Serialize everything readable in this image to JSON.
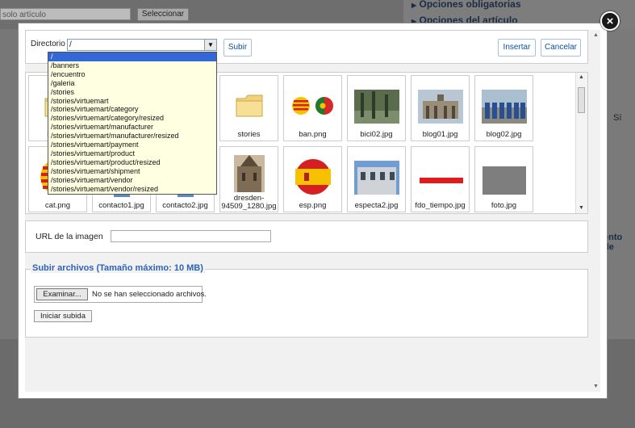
{
  "background": {
    "search_placeholder": "solo artículo",
    "select_button": "Seleccionar",
    "panel_1": "Opciones obligatorias",
    "panel_2": "Opciones del artículo",
    "side_text": "Sí",
    "side_text_2": "ento de"
  },
  "modal": {
    "close_glyph": "×",
    "directory_label": "Directorio",
    "directory_value": "/",
    "upload_button": "Subir",
    "insert_button": "Insertar",
    "cancel_button": "Cancelar",
    "directory_options": [
      "/",
      "/banners",
      "/encuentro",
      "/galeria",
      "/stories",
      "/stories/virtuemart",
      "/stories/virtuemart/category",
      "/stories/virtuemart/category/resized",
      "/stories/virtuemart/manufacturer",
      "/stories/virtuemart/manufacturer/resized",
      "/stories/virtuemart/payment",
      "/stories/virtuemart/product",
      "/stories/virtuemart/product/resized",
      "/stories/virtuemart/shipment",
      "/stories/virtuemart/vendor",
      "/stories/virtuemart/vendor/resized"
    ],
    "images_row1": [
      "banne",
      "",
      "",
      "stories",
      "ban.png",
      "bici02.jpg",
      "blog01.jpg",
      "blog02.jpg"
    ],
    "images_row2": [
      "cat.png",
      "contacto1.jpg",
      "contacto2.jpg",
      "dresden-94509_1280.jpg",
      "esp.png",
      "especta2.jpg",
      "fdo_tiempo.jpg",
      "foto.jpg"
    ],
    "url_label": "URL de la imagen",
    "url_value": "",
    "upload_section_title": "Subir archivos (Tamaño máximo: 10 MB)",
    "browse_button": "Examinar...",
    "no_file_text": "No se han seleccionado archivos.",
    "start_upload_button": "Iniciar subida"
  },
  "colors": {
    "accent": "#0b4f9e",
    "section_title": "#2b63b8",
    "dropdown_bg": "#ffffe1",
    "dropdown_selected": "#3369d6"
  }
}
